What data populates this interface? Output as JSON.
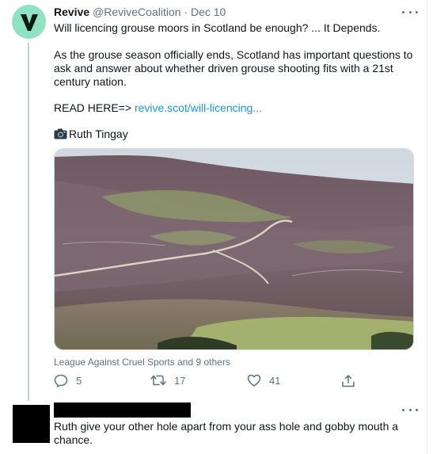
{
  "tweet": {
    "author_name": "Revive",
    "handle": "@ReviveCoalition",
    "separator": "·",
    "date": "Dec 10",
    "line1": "Will licencing grouse moors in Scotland be enough? ... It Depends.",
    "paragraph": "As the grouse season officially ends, Scotland has important questions to ask and answer about whether driven grouse shooting fits with a 21st century nation.",
    "read_prefix": "READ HERE=>",
    "read_link": "revive.scot/will-licencing...",
    "photo_credit": "Ruth Tingay",
    "liked_by": "League Against Cruel Sports and 9 others",
    "replies": "5",
    "retweets": "17",
    "likes": "41",
    "avatar_icon": "revive-logo-icon",
    "camera_icon": "camera-icon",
    "media_description_icon": "moorland-photo"
  },
  "reply": {
    "text": "Ruth give your other hole apart from your ass hole and gobby mouth a chance."
  },
  "colors": {
    "avatar_bg": "#8fe3c4",
    "link": "#1b95e0",
    "muted": "#5b7083",
    "redaction": "#000000"
  }
}
